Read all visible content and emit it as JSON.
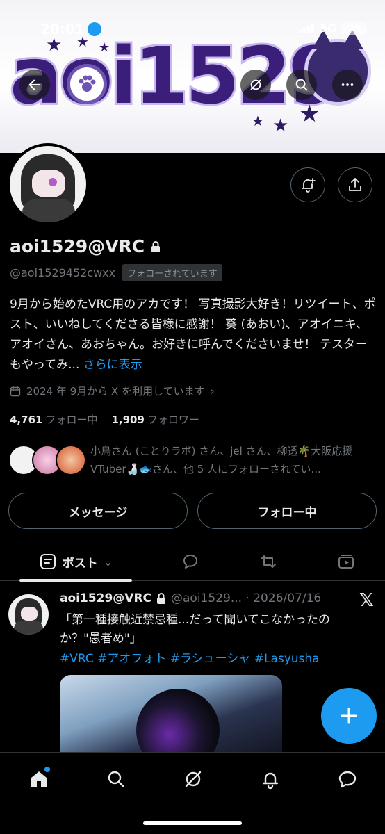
{
  "status_bar": {
    "time": "20:01",
    "network": "5G",
    "battery": "29"
  },
  "banner": {
    "title": "aoi1529"
  },
  "profile": {
    "display_name": "aoi1529@VRC",
    "handle": "@aoi1529452cwxx",
    "follows_you_badge": "フォローされています",
    "bio": "9月から始めたVRC用のアカです！ 写真撮影大好き！リツイート、ポスト、いいねしてくださる皆様に感謝！ 葵 (あおい)、アオイニキ、アオイさん、あおちゃん。お好きに呼んでくださいませ！ テスターもやってみ...",
    "show_more": "さらに表示",
    "joined": "2024 年 9月から X を利用しています",
    "following_count": "4,761",
    "following_label": "フォロー中",
    "followers_count": "1,909",
    "followers_label": "フォロワー",
    "mutuals_text": "小鳥さん (ことりラボ) さん、jel さん、柳透🌴大阪応援 VTuber🍶🐟さん、他 5 人にフォローされてい..."
  },
  "actions": {
    "message": "メッセージ",
    "following": "フォロー中"
  },
  "tabs": {
    "posts": "ポスト"
  },
  "post": {
    "name": "aoi1529@VRC",
    "meta": "@aoi1529... · 2026/07/16",
    "text": "「第一種接触近禁忌種...だって聞いてこなかったのか？\"愚者め\"」",
    "hashtags": "#VRC #アオフォト #ラシューシャ #Lasyusha"
  },
  "colors": {
    "accent": "#1d9bf0",
    "background": "#000000",
    "secondary_text": "#71767b",
    "border": "#536471"
  }
}
